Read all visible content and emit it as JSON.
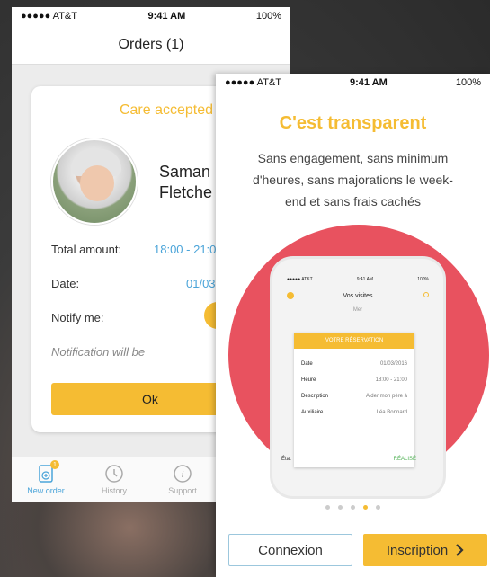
{
  "back": {
    "status": {
      "carrier": "●●●●● AT&T",
      "time": "9:41 AM",
      "battery": "100%"
    },
    "title": "Orders (1)",
    "card": {
      "title": "Care accepted",
      "name_line1": "Saman",
      "name_line2": "Fletche",
      "total_label": "Total amount:",
      "total_value": "18:00 - 21:0",
      "date_label": "Date:",
      "date_value": "01/03",
      "notify_label": "Notify me:",
      "note": "Notification will be",
      "ok": "Ok"
    },
    "tabs": [
      {
        "label": "New order",
        "badge": "1",
        "icon": "new-order-icon"
      },
      {
        "label": "History",
        "icon": "clock-icon"
      },
      {
        "label": "Support",
        "icon": "info-icon"
      }
    ]
  },
  "front": {
    "status": {
      "carrier": "●●●●● AT&T",
      "time": "9:41 AM",
      "battery": "100%"
    },
    "title": "C'est transparent",
    "description": "Sans engagement, sans minimum d'heures, sans majorations le week-end et sans frais cachés",
    "mini": {
      "status_left": "●●●●● AT&T",
      "status_time": "9:41 AM",
      "status_right": "100%",
      "nav_title": "Vos visites",
      "day": "Mer",
      "card_title": "VOTRE RÉSERVATION",
      "rows": [
        {
          "label": "Date",
          "value": "01/03/2016"
        },
        {
          "label": "Heure",
          "value": "18:00 - 21:00"
        },
        {
          "label": "Description",
          "value": "Aider mon père à"
        },
        {
          "label": "Auxiliaire",
          "value": "Léa Bonnard"
        }
      ],
      "state_label": "État",
      "state_value": "RÉALISÉ"
    },
    "pagination": {
      "count": 5,
      "active": 3
    },
    "login": "Connexion",
    "signup": "Inscription",
    "signup_icon": "chevron-right-icon"
  },
  "colors": {
    "accent": "#f5bc33",
    "blue": "#4aa4d9",
    "circle": "#e8525f"
  }
}
